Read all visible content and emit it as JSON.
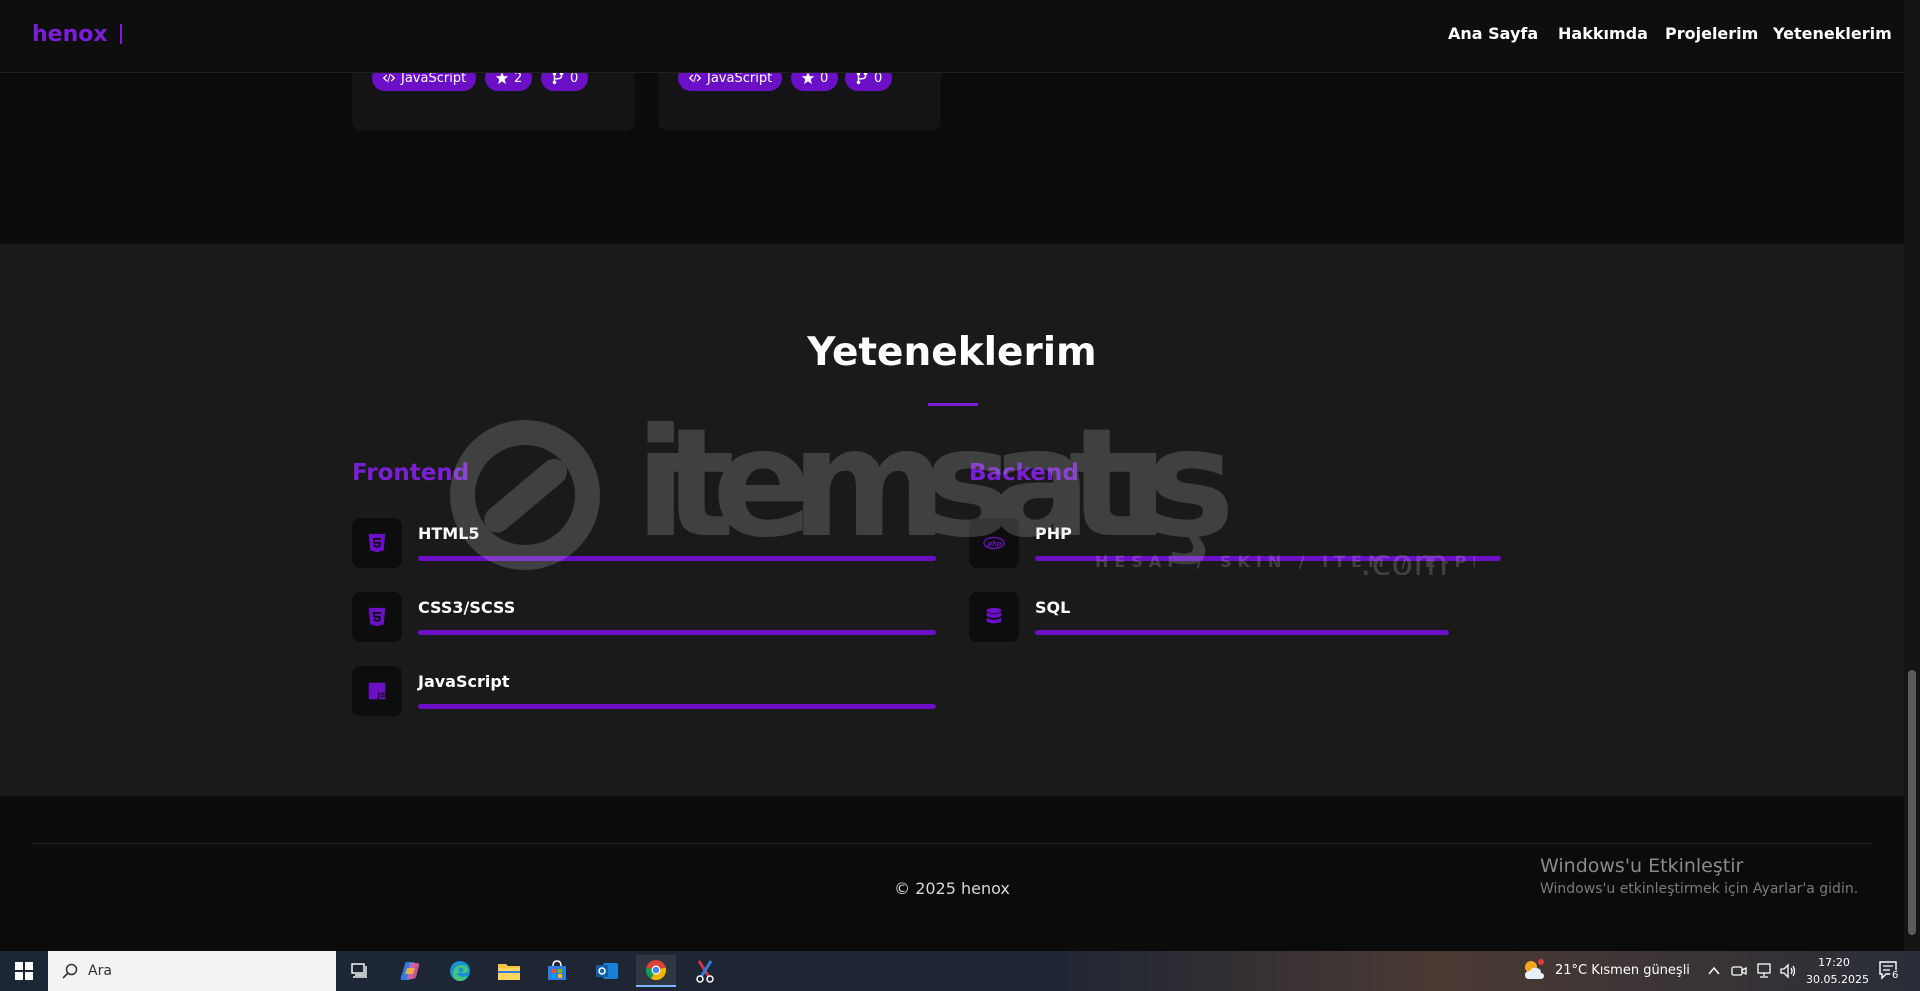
{
  "navbar": {
    "brand": "henox",
    "links": [
      "Ana Sayfa",
      "Hakkımda",
      "Projelerim",
      "Yeteneklerim"
    ]
  },
  "project_cards": [
    {
      "language": "JavaScript",
      "stars": "2",
      "forks": "0"
    },
    {
      "language": "JavaScript",
      "stars": "0",
      "forks": "0"
    }
  ],
  "skills": {
    "title": "Yeteneklerim",
    "frontend": {
      "title": "Frontend",
      "items": [
        {
          "name": "HTML5",
          "icon": "html5-icon",
          "level": 1.0
        },
        {
          "name": "CSS3/SCSS",
          "icon": "css3-icon",
          "level": 1.0
        },
        {
          "name": "JavaScript",
          "icon": "javascript-icon",
          "level": 1.0
        }
      ]
    },
    "backend": {
      "title": "Backend",
      "items": [
        {
          "name": "PHP",
          "icon": "php-icon",
          "level": 0.9
        },
        {
          "name": "SQL",
          "icon": "database-icon",
          "level": 0.8
        }
      ]
    }
  },
  "watermark": {
    "name": "itemsatış",
    "tagline": "HESAP / SKIN / ITEM / E-PIN",
    "suffix": ".com"
  },
  "footer": {
    "copyright": "© 2025 henox",
    "activation_title": "Windows'u Etkinleştir",
    "activation_subtitle": "Windows'u etkinleştirmek için Ayarlar'a gidin."
  },
  "taskbar": {
    "search_placeholder": "Ara",
    "weather": "21°C  Kısmen güneşli",
    "time": "17:20",
    "date": "30.05.2025",
    "notification_count": "6"
  },
  "colors": {
    "accent": "#7a1fd6",
    "badge": "#6c10c8",
    "bg": "#0b0b0c",
    "section": "#1a1a1b"
  }
}
